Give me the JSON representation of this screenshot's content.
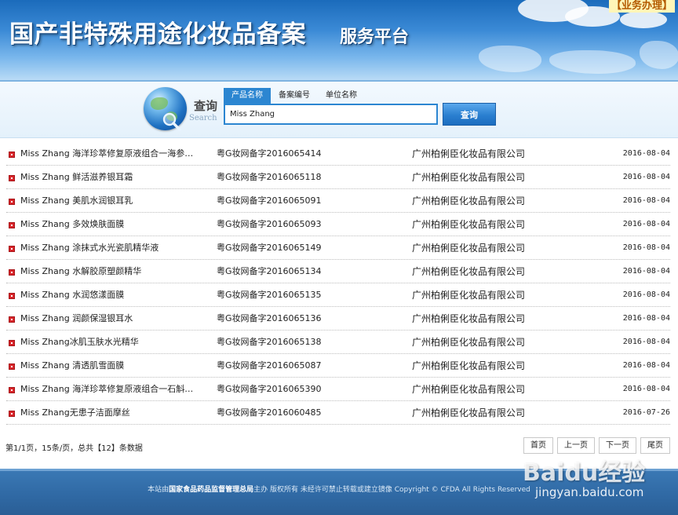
{
  "header": {
    "title": "国产非特殊用途化妆品备案",
    "subtitle": "服务平台",
    "business_link": "【业务办理】"
  },
  "search": {
    "label_cn": "查询",
    "label_en": "Search",
    "tabs": [
      {
        "label": "产品名称",
        "active": true
      },
      {
        "label": "备案编号",
        "active": false
      },
      {
        "label": "单位名称",
        "active": false
      }
    ],
    "value": "Miss Zhang",
    "button_label": "查询"
  },
  "results": [
    {
      "name": "Miss Zhang 海洋珍萃修复原液组合一海参…",
      "record_no": "粤G妆网备字2016065414",
      "company": "广州柏俐臣化妆品有限公司",
      "date": "2016-08-04"
    },
    {
      "name": "Miss Zhang 鲜活滋养银耳霜",
      "record_no": "粤G妆网备字2016065118",
      "company": "广州柏俐臣化妆品有限公司",
      "date": "2016-08-04"
    },
    {
      "name": "Miss Zhang 美肌水润银耳乳",
      "record_no": "粤G妆网备字2016065091",
      "company": "广州柏俐臣化妆品有限公司",
      "date": "2016-08-04"
    },
    {
      "name": "Miss Zhang 多效焕肤面膜",
      "record_no": "粤G妆网备字2016065093",
      "company": "广州柏俐臣化妆品有限公司",
      "date": "2016-08-04"
    },
    {
      "name": "Miss Zhang 涂抹式水光瓷肌精华液",
      "record_no": "粤G妆网备字2016065149",
      "company": "广州柏俐臣化妆品有限公司",
      "date": "2016-08-04"
    },
    {
      "name": "Miss Zhang 水解胶原塑颜精华",
      "record_no": "粤G妆网备字2016065134",
      "company": "广州柏俐臣化妆品有限公司",
      "date": "2016-08-04"
    },
    {
      "name": "Miss Zhang 水润悠漾面膜",
      "record_no": "粤G妆网备字2016065135",
      "company": "广州柏俐臣化妆品有限公司",
      "date": "2016-08-04"
    },
    {
      "name": "Miss Zhang 润颜保湿银耳水",
      "record_no": "粤G妆网备字2016065136",
      "company": "广州柏俐臣化妆品有限公司",
      "date": "2016-08-04"
    },
    {
      "name": "Miss Zhang冰肌玉肤水光精华",
      "record_no": "粤G妆网备字2016065138",
      "company": "广州柏俐臣化妆品有限公司",
      "date": "2016-08-04"
    },
    {
      "name": "Miss Zhang 清透肌雪面膜",
      "record_no": "粤G妆网备字2016065087",
      "company": "广州柏俐臣化妆品有限公司",
      "date": "2016-08-04"
    },
    {
      "name": "Miss Zhang 海洋珍萃修复原液组合一石斛…",
      "record_no": "粤G妆网备字2016065390",
      "company": "广州柏俐臣化妆品有限公司",
      "date": "2016-08-04"
    },
    {
      "name": "Miss Zhang无患子洁面摩丝",
      "record_no": "粤G妆网备字2016060485",
      "company": "广州柏俐臣化妆品有限公司",
      "date": "2016-07-26"
    }
  ],
  "pager": {
    "info": "第1/1页，15条/页，总共【12】条数据",
    "first": "首页",
    "prev": "上一页",
    "next": "下一页",
    "last": "尾页"
  },
  "footer": {
    "prefix": "本站由",
    "org": "国家食品药品监督管理总局",
    "suffix": "主办 版权所有 未经许可禁止转载或建立镜像 Copyright © CFDA All Rights Reserved"
  },
  "watermark": {
    "logo": "Baidu经验",
    "url": "jingyan.baidu.com"
  },
  "colors": {
    "accent": "#2c86d1",
    "bullet": "#d8262b",
    "business_link_text": "#b35a00",
    "footer_bg": "#2f68a3"
  }
}
